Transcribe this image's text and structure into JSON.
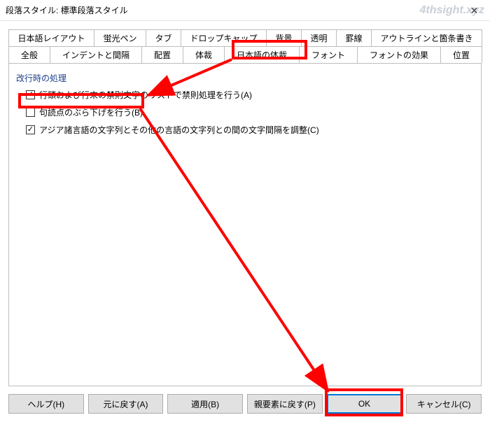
{
  "watermark": "4thsight.xyz",
  "title": "段落スタイル: 標準段落スタイル",
  "tabs_row1": [
    "日本語レイアウト",
    "蛍光ペン",
    "タブ",
    "ドロップキャップ",
    "背景",
    "透明",
    "罫線",
    "アウトラインと箇条書き"
  ],
  "tabs_row2": [
    "全般",
    "インデントと間隔",
    "配置",
    "体裁",
    "日本語の体裁",
    "フォント",
    "フォントの効果",
    "位置"
  ],
  "selected_tab": "日本語の体裁",
  "section": {
    "heading": "改行時の処理",
    "opts": [
      {
        "label": "行頭および行末の禁則文字のリストで禁則処理を行う(A)",
        "checked": true
      },
      {
        "label": "句読点のぶら下げを行う(B)",
        "checked": false
      },
      {
        "label": "アジア諸言語の文字列とその他の言語の文字列との間の文字間隔を調整(C)",
        "checked": true
      }
    ]
  },
  "buttons": {
    "help": "ヘルプ(H)",
    "reset": "元に戻す(A)",
    "apply": "適用(B)",
    "parent": "親要素に戻す(P)",
    "ok": "OK",
    "cancel": "キャンセル(C)"
  }
}
